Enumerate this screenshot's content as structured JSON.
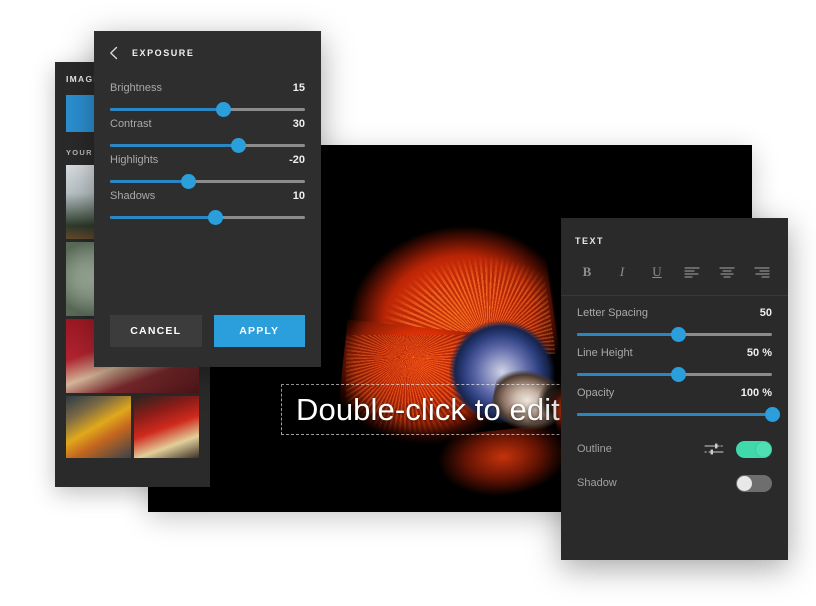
{
  "sidebar": {
    "title": "IMAGE MANAGER",
    "uploads_label": "YOUR UPLOADS",
    "swatch_color": "#2b8fd0",
    "thumbnails": [
      {
        "name": "mountain-forest-thumb"
      },
      {
        "name": "succulent-plant-thumb"
      },
      {
        "name": "woman-red-wall-thumb"
      },
      {
        "name": "hand-portrait-thumb"
      },
      {
        "name": "taxi-street-thumb"
      },
      {
        "name": "red-classic-car-thumb"
      }
    ]
  },
  "exposure": {
    "title": "EXPOSURE",
    "back_icon": "chevron-left-icon",
    "sliders": [
      {
        "label": "Brightness",
        "value": "15",
        "percent": 58
      },
      {
        "label": "Contrast",
        "value": "30",
        "percent": 66
      },
      {
        "label": "Highlights",
        "value": "-20",
        "percent": 40
      },
      {
        "label": "Shadows",
        "value": "10",
        "percent": 54
      }
    ],
    "cancel_label": "CANCEL",
    "apply_label": "APPLY",
    "accent_color": "#2b9fdc"
  },
  "text_panel": {
    "title": "TEXT",
    "tools": [
      {
        "label": "B",
        "name": "bold-icon"
      },
      {
        "label": "I",
        "name": "italic-icon"
      },
      {
        "label": "U",
        "name": "underline-icon"
      },
      {
        "label": "",
        "name": "align-left-icon"
      },
      {
        "label": "",
        "name": "align-center-icon"
      },
      {
        "label": "",
        "name": "align-right-icon"
      }
    ],
    "sliders": [
      {
        "label": "Letter Spacing",
        "value": "50",
        "percent": 52
      },
      {
        "label": "Line Height",
        "value": "50 %",
        "percent": 52
      },
      {
        "label": "Opacity",
        "value": "100 %",
        "percent": 100
      }
    ],
    "toggles": [
      {
        "label": "Outline",
        "state": "on",
        "icon": "outline-settings-icon"
      },
      {
        "label": "Shadow",
        "state": "off",
        "icon": ""
      }
    ],
    "on_color": "#3fd9ac",
    "off_color": "#6e6e6e"
  },
  "canvas": {
    "text_object": "Double-click to edit text",
    "photo_name": "betta-fish-photo",
    "handle_color": "#2b9fdc"
  }
}
